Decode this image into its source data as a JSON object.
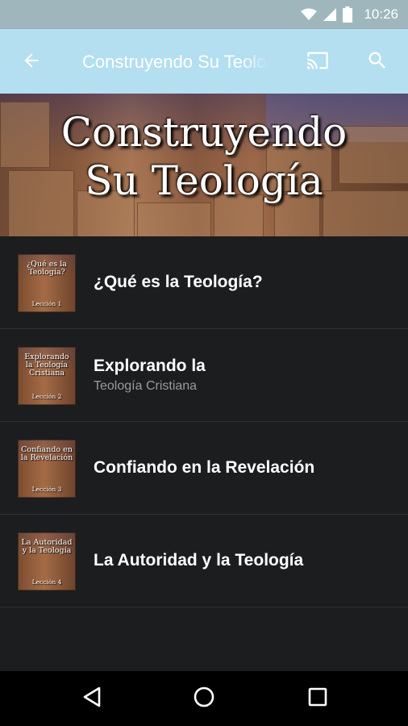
{
  "status_bar": {
    "time": "10:26",
    "icons": [
      "wifi-icon",
      "cell-signal-icon",
      "battery-icon"
    ]
  },
  "app_bar": {
    "title": "Construyendo Su Teología",
    "back_icon": "arrow-back-icon",
    "actions": [
      "cast-icon",
      "search-icon"
    ],
    "background": "#b3dff0"
  },
  "banner": {
    "title_line1": "Construyendo",
    "title_line2": "Su Teología"
  },
  "lessons": [
    {
      "title": "¿Qué es la Teología?",
      "subtitle": "",
      "thumb_title": "¿Qué es la Teología?",
      "thumb_lesson": "Lección 1"
    },
    {
      "title": "Explorando la",
      "subtitle": "Teología Cristiana",
      "thumb_title": "Explorando la Teología Cristiana",
      "thumb_lesson": "Lección 2"
    },
    {
      "title": "Confiando en la Revelación",
      "subtitle": "",
      "thumb_title": "Confiando en la Revelación",
      "thumb_lesson": "Lección 3"
    },
    {
      "title": "La Autoridad y la Teología",
      "subtitle": "",
      "thumb_title": "La Autoridad y la Teología",
      "thumb_lesson": "Lección 4"
    }
  ],
  "nav_bar": {
    "buttons": [
      "back-triangle-icon",
      "home-circle-icon",
      "recents-square-icon"
    ]
  }
}
